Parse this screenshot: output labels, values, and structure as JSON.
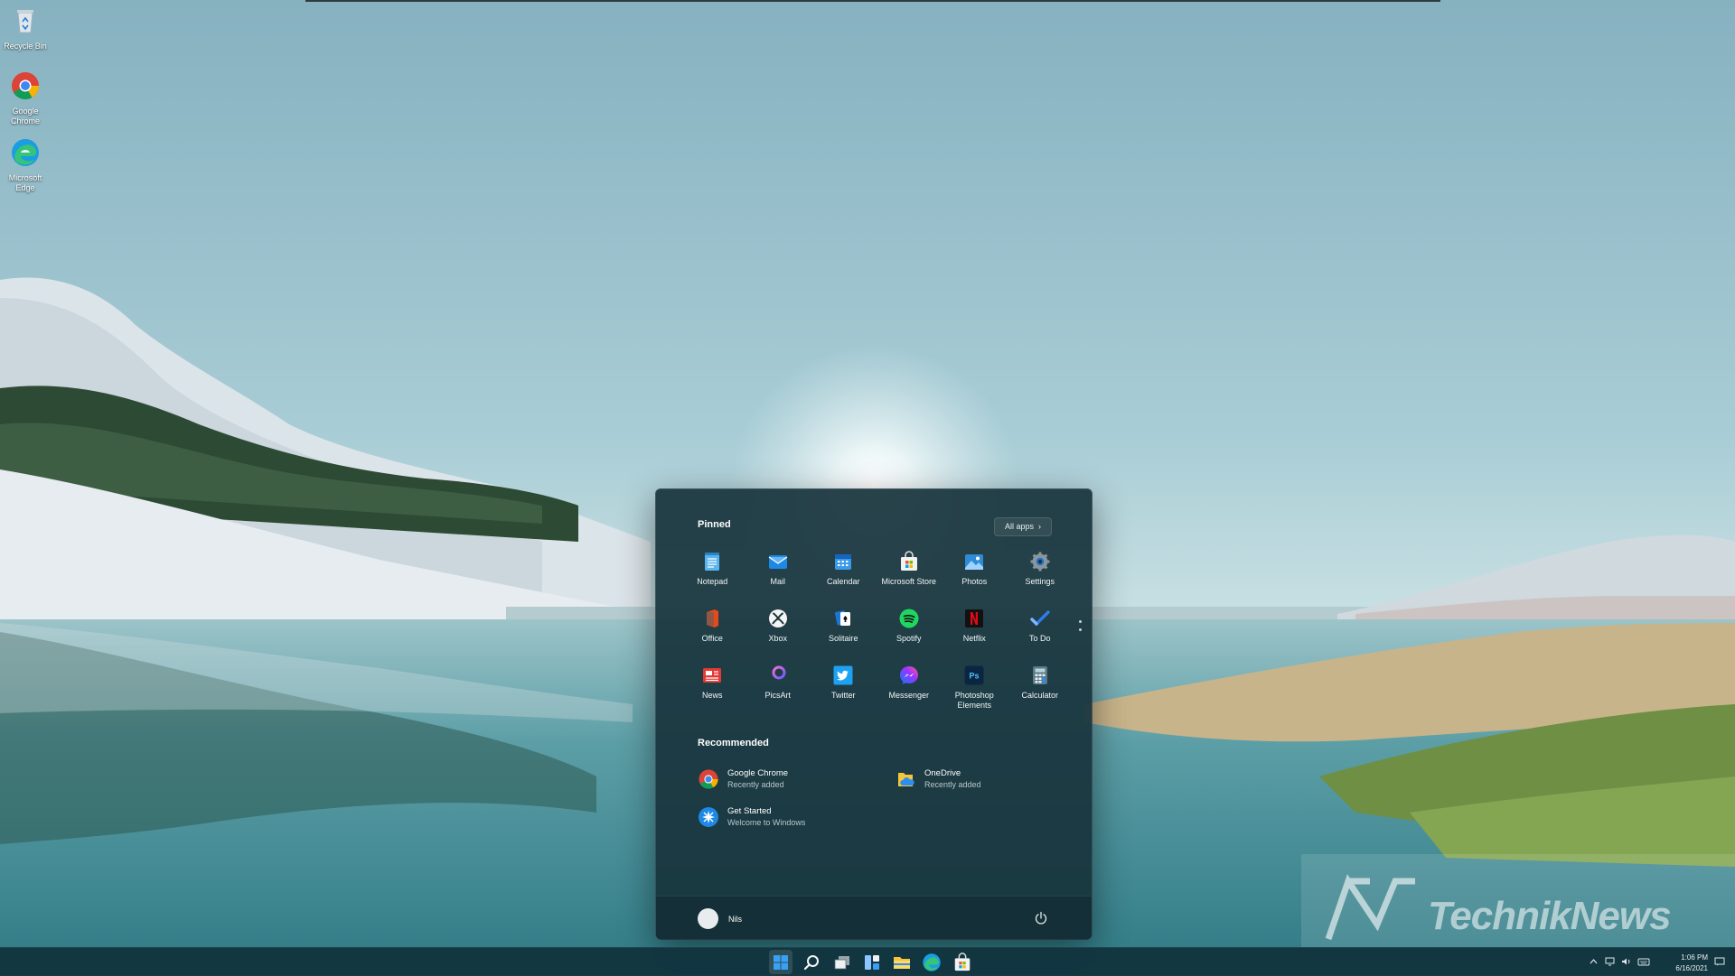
{
  "desktop": {
    "icons": [
      {
        "label": "Recycle Bin",
        "icon": "recycle-bin-icon"
      },
      {
        "label": "Google Chrome",
        "icon": "chrome-icon"
      },
      {
        "label": "Microsoft Edge",
        "icon": "edge-icon"
      }
    ]
  },
  "start_menu": {
    "pinned_title": "Pinned",
    "all_apps_label": "All apps",
    "pinned": [
      {
        "label": "Notepad",
        "icon": "notepad-icon"
      },
      {
        "label": "Mail",
        "icon": "mail-icon"
      },
      {
        "label": "Calendar",
        "icon": "calendar-icon"
      },
      {
        "label": "Microsoft Store",
        "icon": "store-icon"
      },
      {
        "label": "Photos",
        "icon": "photos-icon"
      },
      {
        "label": "Settings",
        "icon": "gear-icon"
      },
      {
        "label": "Office",
        "icon": "office-icon"
      },
      {
        "label": "Xbox",
        "icon": "xbox-icon"
      },
      {
        "label": "Solitaire",
        "icon": "solitaire-icon"
      },
      {
        "label": "Spotify",
        "icon": "spotify-icon"
      },
      {
        "label": "Netflix",
        "icon": "netflix-icon"
      },
      {
        "label": "To Do",
        "icon": "todo-icon"
      },
      {
        "label": "News",
        "icon": "news-icon"
      },
      {
        "label": "PicsArt",
        "icon": "picsart-icon"
      },
      {
        "label": "Twitter",
        "icon": "twitter-icon"
      },
      {
        "label": "Messenger",
        "icon": "messenger-icon"
      },
      {
        "label": "Photoshop Elements",
        "icon": "photoshop-icon"
      },
      {
        "label": "Calculator",
        "icon": "calculator-icon"
      }
    ],
    "recommended_title": "Recommended",
    "recommended": [
      {
        "title": "Google Chrome",
        "subtitle": "Recently added",
        "icon": "chrome-icon"
      },
      {
        "title": "OneDrive",
        "subtitle": "Recently added",
        "icon": "onedrive-icon"
      },
      {
        "title": "Get Started",
        "subtitle": "Welcome to Windows",
        "icon": "get-started-icon"
      }
    ],
    "user_name": "Nils",
    "power_icon": "power-icon"
  },
  "taskbar": {
    "icons": [
      "windows-start-icon",
      "search-icon",
      "task-view-icon",
      "widgets-icon",
      "file-explorer-icon",
      "edge-icon",
      "store-icon"
    ],
    "time": "1:06 PM",
    "date": "6/16/2021"
  },
  "watermark": {
    "text": "TechnikNews"
  },
  "colors": {
    "start_menu_bg": "#18343c",
    "taskbar_bg": "#12343e",
    "accent": "#0078d4"
  }
}
